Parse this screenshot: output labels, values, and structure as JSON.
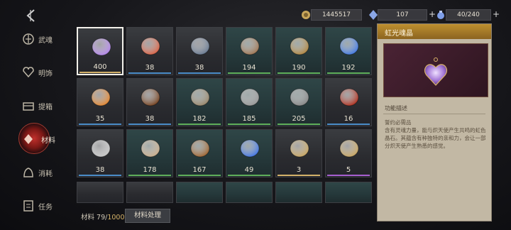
{
  "resources": [
    {
      "icon": "coin-icon",
      "value": "1445517",
      "has_plus": false
    },
    {
      "icon": "crystal-icon",
      "value": "107",
      "has_plus": true
    },
    {
      "icon": "potion-icon",
      "value": "40/240",
      "has_plus": true
    }
  ],
  "sidebar": {
    "items": [
      {
        "label": "武魂",
        "icon": "soul-icon"
      },
      {
        "label": "明饰",
        "icon": "ornament-icon"
      },
      {
        "label": "提箱",
        "icon": "chest-icon"
      },
      {
        "label": "材料",
        "icon": "material-icon",
        "active": true
      },
      {
        "label": "消耗",
        "icon": "consumable-icon"
      },
      {
        "label": "任务",
        "icon": "task-icon"
      }
    ]
  },
  "grid": {
    "items": [
      {
        "name": "rainbow-soul-crystal",
        "count": "400",
        "bar": "#d4b26a",
        "sel": true,
        "teal": false
      },
      {
        "name": "butterfly-wing",
        "count": "38",
        "bar": "#4a8cc8",
        "teal": false
      },
      {
        "name": "bottle",
        "count": "38",
        "bar": "#4a8cc8",
        "teal": false
      },
      {
        "name": "bandage-bundle",
        "count": "194",
        "bar": "#5fae5a",
        "teal": true
      },
      {
        "name": "bronze-medal",
        "count": "190",
        "bar": "#5fae5a",
        "teal": true
      },
      {
        "name": "blue-flame",
        "count": "192",
        "bar": "#5fae5a",
        "teal": true
      },
      {
        "name": "amber-shard",
        "count": "35",
        "bar": "#4a8cc8",
        "teal": false
      },
      {
        "name": "leather-book",
        "count": "38",
        "bar": "#4a8cc8",
        "teal": false
      },
      {
        "name": "gear",
        "count": "182",
        "bar": "#5fae5a",
        "teal": true
      },
      {
        "name": "metal-plate",
        "count": "185",
        "bar": "#5fae5a",
        "teal": true
      },
      {
        "name": "hook",
        "count": "205",
        "bar": "#5fae5a",
        "teal": true
      },
      {
        "name": "red-beetle",
        "count": "16",
        "bar": "#4a8cc8",
        "teal": false
      },
      {
        "name": "feather",
        "count": "38",
        "bar": "#4a8cc8",
        "teal": false
      },
      {
        "name": "skull-bones",
        "count": "178",
        "bar": "#5fae5a",
        "teal": true
      },
      {
        "name": "leather-scrap",
        "count": "167",
        "bar": "#5fae5a",
        "teal": true
      },
      {
        "name": "blue-potion",
        "count": "49",
        "bar": "#5fae5a",
        "teal": true
      },
      {
        "name": "jeweled-hammer",
        "count": "3",
        "bar": "#d4b26a",
        "teal": false
      },
      {
        "name": "gold-hammer",
        "count": "5",
        "bar": "#a75fd0",
        "teal": false
      }
    ]
  },
  "footer": {
    "material_label": "材料 79/",
    "material_max": "10000",
    "process_button": "材料处理"
  },
  "panel": {
    "title": "虹光魂晶",
    "function_label": "功能描述",
    "desc_title": "誓约必需品",
    "desc": "含有灵魂力量，能与炽天使产生共鸣的虹色晶石。其蕴含有种独特的亲和力，会让一部分炽天使产生熟悉的感觉。"
  },
  "colors": {
    "accent": "#bd8f2f",
    "panel_bg": "#c2b8a4"
  }
}
